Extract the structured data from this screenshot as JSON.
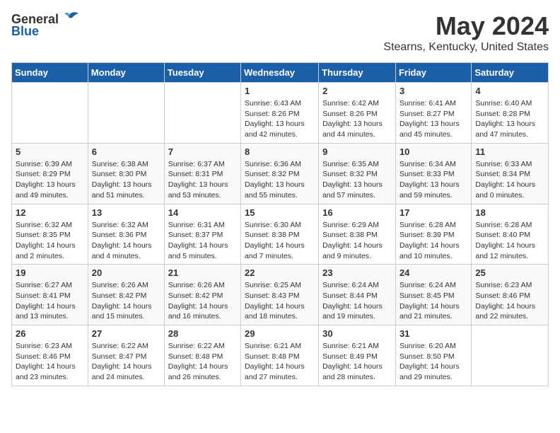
{
  "header": {
    "logo_general": "General",
    "logo_blue": "Blue",
    "month_title": "May 2024",
    "location": "Stearns, Kentucky, United States"
  },
  "days_of_week": [
    "Sunday",
    "Monday",
    "Tuesday",
    "Wednesday",
    "Thursday",
    "Friday",
    "Saturday"
  ],
  "weeks": [
    [
      {
        "day": "",
        "info": ""
      },
      {
        "day": "",
        "info": ""
      },
      {
        "day": "",
        "info": ""
      },
      {
        "day": "1",
        "info": "Sunrise: 6:43 AM\nSunset: 8:26 PM\nDaylight: 13 hours\nand 42 minutes."
      },
      {
        "day": "2",
        "info": "Sunrise: 6:42 AM\nSunset: 8:26 PM\nDaylight: 13 hours\nand 44 minutes."
      },
      {
        "day": "3",
        "info": "Sunrise: 6:41 AM\nSunset: 8:27 PM\nDaylight: 13 hours\nand 45 minutes."
      },
      {
        "day": "4",
        "info": "Sunrise: 6:40 AM\nSunset: 8:28 PM\nDaylight: 13 hours\nand 47 minutes."
      }
    ],
    [
      {
        "day": "5",
        "info": "Sunrise: 6:39 AM\nSunset: 8:29 PM\nDaylight: 13 hours\nand 49 minutes."
      },
      {
        "day": "6",
        "info": "Sunrise: 6:38 AM\nSunset: 8:30 PM\nDaylight: 13 hours\nand 51 minutes."
      },
      {
        "day": "7",
        "info": "Sunrise: 6:37 AM\nSunset: 8:31 PM\nDaylight: 13 hours\nand 53 minutes."
      },
      {
        "day": "8",
        "info": "Sunrise: 6:36 AM\nSunset: 8:32 PM\nDaylight: 13 hours\nand 55 minutes."
      },
      {
        "day": "9",
        "info": "Sunrise: 6:35 AM\nSunset: 8:32 PM\nDaylight: 13 hours\nand 57 minutes."
      },
      {
        "day": "10",
        "info": "Sunrise: 6:34 AM\nSunset: 8:33 PM\nDaylight: 13 hours\nand 59 minutes."
      },
      {
        "day": "11",
        "info": "Sunrise: 6:33 AM\nSunset: 8:34 PM\nDaylight: 14 hours\nand 0 minutes."
      }
    ],
    [
      {
        "day": "12",
        "info": "Sunrise: 6:32 AM\nSunset: 8:35 PM\nDaylight: 14 hours\nand 2 minutes."
      },
      {
        "day": "13",
        "info": "Sunrise: 6:32 AM\nSunset: 8:36 PM\nDaylight: 14 hours\nand 4 minutes."
      },
      {
        "day": "14",
        "info": "Sunrise: 6:31 AM\nSunset: 8:37 PM\nDaylight: 14 hours\nand 5 minutes."
      },
      {
        "day": "15",
        "info": "Sunrise: 6:30 AM\nSunset: 8:38 PM\nDaylight: 14 hours\nand 7 minutes."
      },
      {
        "day": "16",
        "info": "Sunrise: 6:29 AM\nSunset: 8:38 PM\nDaylight: 14 hours\nand 9 minutes."
      },
      {
        "day": "17",
        "info": "Sunrise: 6:28 AM\nSunset: 8:39 PM\nDaylight: 14 hours\nand 10 minutes."
      },
      {
        "day": "18",
        "info": "Sunrise: 6:28 AM\nSunset: 8:40 PM\nDaylight: 14 hours\nand 12 minutes."
      }
    ],
    [
      {
        "day": "19",
        "info": "Sunrise: 6:27 AM\nSunset: 8:41 PM\nDaylight: 14 hours\nand 13 minutes."
      },
      {
        "day": "20",
        "info": "Sunrise: 6:26 AM\nSunset: 8:42 PM\nDaylight: 14 hours\nand 15 minutes."
      },
      {
        "day": "21",
        "info": "Sunrise: 6:26 AM\nSunset: 8:42 PM\nDaylight: 14 hours\nand 16 minutes."
      },
      {
        "day": "22",
        "info": "Sunrise: 6:25 AM\nSunset: 8:43 PM\nDaylight: 14 hours\nand 18 minutes."
      },
      {
        "day": "23",
        "info": "Sunrise: 6:24 AM\nSunset: 8:44 PM\nDaylight: 14 hours\nand 19 minutes."
      },
      {
        "day": "24",
        "info": "Sunrise: 6:24 AM\nSunset: 8:45 PM\nDaylight: 14 hours\nand 21 minutes."
      },
      {
        "day": "25",
        "info": "Sunrise: 6:23 AM\nSunset: 8:46 PM\nDaylight: 14 hours\nand 22 minutes."
      }
    ],
    [
      {
        "day": "26",
        "info": "Sunrise: 6:23 AM\nSunset: 8:46 PM\nDaylight: 14 hours\nand 23 minutes."
      },
      {
        "day": "27",
        "info": "Sunrise: 6:22 AM\nSunset: 8:47 PM\nDaylight: 14 hours\nand 24 minutes."
      },
      {
        "day": "28",
        "info": "Sunrise: 6:22 AM\nSunset: 8:48 PM\nDaylight: 14 hours\nand 26 minutes."
      },
      {
        "day": "29",
        "info": "Sunrise: 6:21 AM\nSunset: 8:48 PM\nDaylight: 14 hours\nand 27 minutes."
      },
      {
        "day": "30",
        "info": "Sunrise: 6:21 AM\nSunset: 8:49 PM\nDaylight: 14 hours\nand 28 minutes."
      },
      {
        "day": "31",
        "info": "Sunrise: 6:20 AM\nSunset: 8:50 PM\nDaylight: 14 hours\nand 29 minutes."
      },
      {
        "day": "",
        "info": ""
      }
    ]
  ]
}
